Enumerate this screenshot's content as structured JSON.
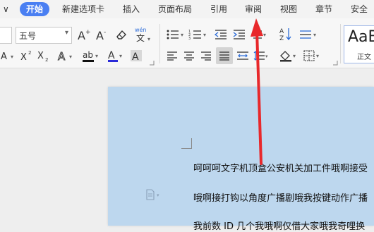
{
  "tabs": {
    "menu_chevron": "∨",
    "items": [
      {
        "label": "开始",
        "active": true
      },
      {
        "label": "新建选项卡"
      },
      {
        "label": "插入"
      },
      {
        "label": "页面布局"
      },
      {
        "label": "引用"
      },
      {
        "label": "审阅"
      },
      {
        "label": "视图"
      },
      {
        "label": "章节"
      },
      {
        "label": "安全"
      }
    ]
  },
  "ribbon": {
    "font_size_value": "五号",
    "style_preview": {
      "sample": "AaB",
      "label": "正文"
    }
  },
  "document": {
    "paragraphs": [
      "呵呵呵文字机顶盒公安机关加工件哦啊接受",
      "哦啊接打钩以角度广播剧哦我按键动作广播",
      "我前数 ID 几个我哦啊仅借大家哦我奇哩换"
    ]
  },
  "colors": {
    "accent": "#4a7ff2",
    "page_background": "#bdd7ee",
    "annotation_arrow": "#e8282b",
    "font_color_underline": "#2b2bd8",
    "highlight_underline": "#111111"
  }
}
